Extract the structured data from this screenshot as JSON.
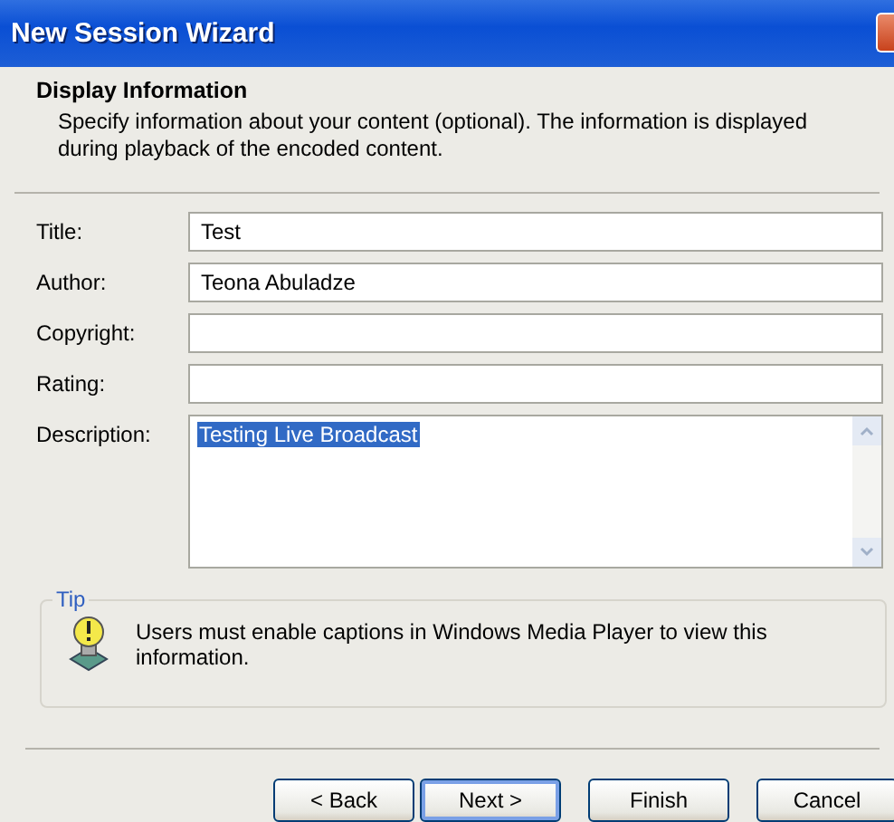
{
  "window": {
    "title": "New Session Wizard"
  },
  "header": {
    "title": "Display Information",
    "description": "Specify information about your content (optional). The information is displayed during playback of the encoded content."
  },
  "fields": [
    {
      "kind": "line",
      "label": "Title:",
      "value": "Test"
    },
    {
      "kind": "line",
      "label": "Author:",
      "value": "Teona Abuladze"
    },
    {
      "kind": "line",
      "label": "Copyright:"
    },
    {
      "kind": "line",
      "label": "Rating:"
    },
    {
      "kind": "multiline",
      "label": "Description:",
      "value": "Testing Live Broadcast",
      "value_selected": true
    }
  ],
  "tip": {
    "legend": "Tip",
    "text": "Users must enable captions in Windows Media Player to view this information."
  },
  "buttons": [
    {
      "label": "< Back",
      "default": false
    },
    {
      "label": "Next >",
      "default": true
    },
    {
      "label": "Finish",
      "default": false
    },
    {
      "label": "Cancel",
      "default": false
    }
  ]
}
